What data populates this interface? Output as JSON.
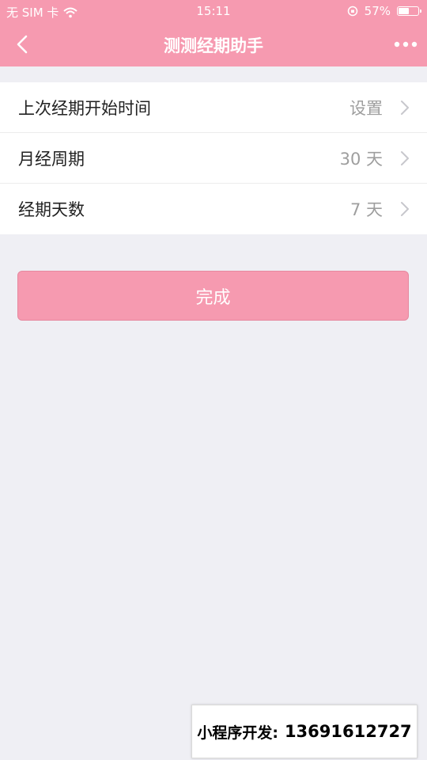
{
  "status_bar": {
    "carrier": "无 SIM 卡",
    "time": "15:11",
    "battery_percent": "57%",
    "battery_level": 0.57,
    "icons": [
      "wifi-icon",
      "orientation-lock-icon",
      "battery-icon"
    ]
  },
  "nav": {
    "title": "测测经期助手",
    "back_icon": "chevron-left-icon",
    "more_icon": "more-dots-icon"
  },
  "settings": [
    {
      "label": "上次经期开始时间",
      "value": "设置"
    },
    {
      "label": "月经周期",
      "value": "30 天"
    },
    {
      "label": "经期天数",
      "value": "7 天"
    }
  ],
  "done_button": {
    "label": "完成"
  },
  "watermark": {
    "label": "小程序开发:",
    "phone": "13691612727"
  },
  "colors": {
    "accent": "#f69ab0",
    "background": "#efeff4",
    "value_text": "#9e9e9e"
  }
}
